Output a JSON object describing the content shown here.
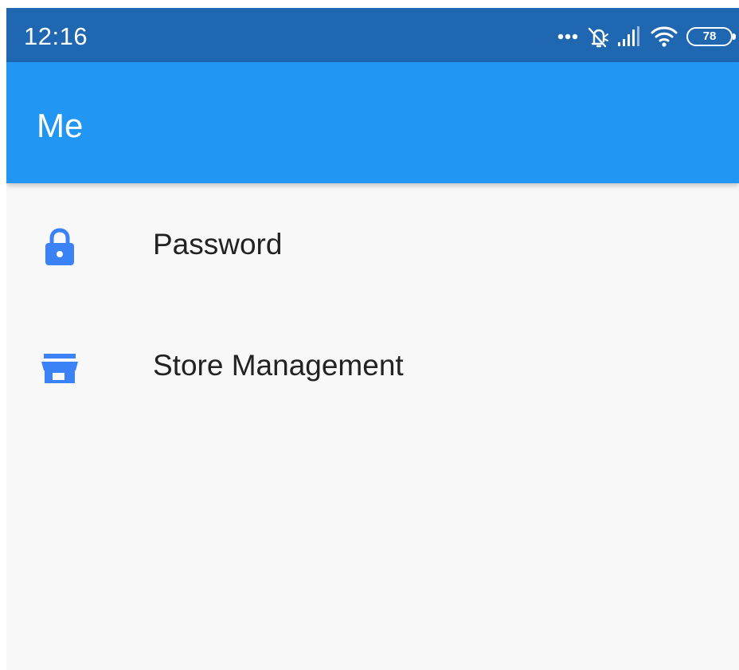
{
  "status_bar": {
    "time": "12:16",
    "battery_level": "78",
    "background_color": "#1f68b1",
    "icons": [
      "more-dots-icon",
      "alarm-off-icon",
      "cellular-signal-icon",
      "wifi-icon",
      "battery-icon"
    ]
  },
  "app_bar": {
    "title": "Me",
    "background_color": "#2196f3"
  },
  "menu": {
    "items": [
      {
        "label": "Password",
        "icon": "lock-icon",
        "icon_color": "#3b82f6"
      },
      {
        "label": "Store Management",
        "icon": "store-icon",
        "icon_color": "#3b82f6"
      }
    ]
  }
}
